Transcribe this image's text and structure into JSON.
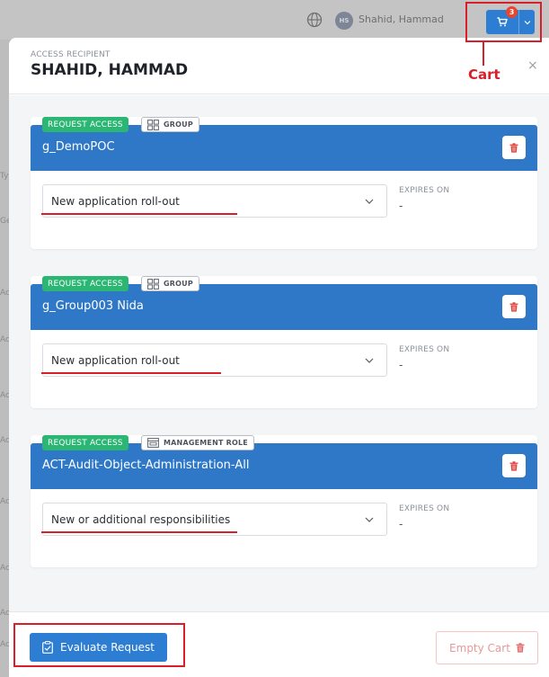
{
  "background": {
    "user_initials": "HS",
    "user_name": "Shahid, Hammad",
    "left_clip_chars": [
      "Ty",
      "Ge",
      "Ac",
      "Ac",
      "Ac",
      "Ac",
      "Ac",
      "Ac",
      "Ac",
      "Ac",
      "Ac"
    ]
  },
  "cart": {
    "count": "3",
    "annotation_label": "Cart"
  },
  "modal": {
    "recipient_label": "ACCESS RECIPIENT",
    "recipient_name": "SHAHID, HAMMAD",
    "close_glyph": "×",
    "items": [
      {
        "request_badge": "REQUEST ACCESS",
        "type_label": "GROUP",
        "type_icon": "group-icon",
        "title": "g_DemoPOC",
        "reason": "New application roll-out",
        "expires_label": "EXPIRES ON",
        "expires_value": "-"
      },
      {
        "request_badge": "REQUEST ACCESS",
        "type_label": "GROUP",
        "type_icon": "group-icon",
        "title": "g_Group003 Nida",
        "reason": "New application roll-out",
        "expires_label": "EXPIRES ON",
        "expires_value": "-"
      },
      {
        "request_badge": "REQUEST ACCESS",
        "type_label": "MANAGEMENT ROLE",
        "type_icon": "management-role-icon",
        "title": "ACT-Audit-Object-Administration-All",
        "reason": "New or additional responsibilities",
        "expires_label": "EXPIRES ON",
        "expires_value": "-"
      }
    ],
    "footer": {
      "evaluate_label": "Evaluate Request",
      "empty_cart_label": "Empty Cart"
    }
  },
  "colors": {
    "primary": "#2d7dd2",
    "card_header": "#2f78c7",
    "badge_green": "#2bb673",
    "annotation_red": "#d9202a",
    "danger": "#e8452f"
  }
}
